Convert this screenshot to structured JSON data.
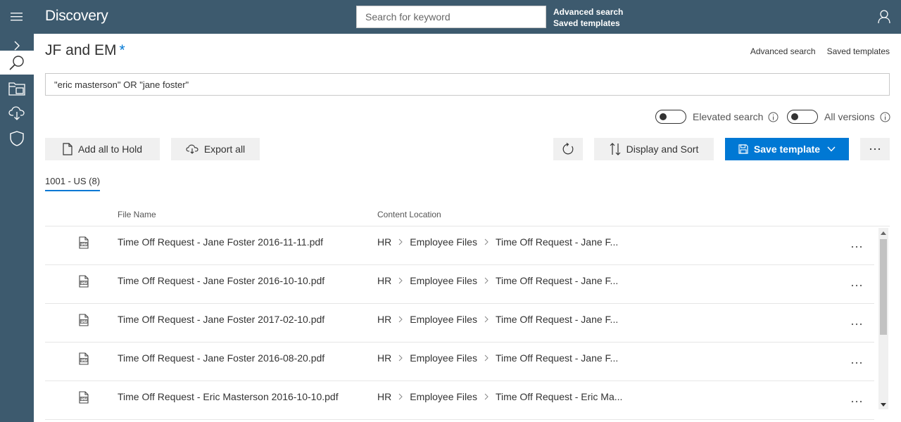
{
  "app": {
    "title": "Discovery",
    "search_placeholder": "Search for keyword",
    "top_links": [
      "Advanced search",
      "Saved templates"
    ]
  },
  "leftnav": {
    "items": [
      {
        "icon": "chevron-right-icon"
      },
      {
        "icon": "search-icon",
        "active": true
      },
      {
        "icon": "folders-icon"
      },
      {
        "icon": "cloud-download-icon"
      },
      {
        "icon": "shield-icon"
      }
    ]
  },
  "page": {
    "title": "JF and EM",
    "unsaved_marker": "*",
    "links": [
      "Advanced search",
      "Saved templates"
    ],
    "query": "\"eric masterson\" OR \"jane foster\""
  },
  "toggles": {
    "elevated_search": {
      "label": "Elevated search",
      "on": false
    },
    "all_versions": {
      "label": "All versions",
      "on": false
    }
  },
  "toolbar": {
    "add_hold": "Add all to Hold",
    "export_all": "Export all",
    "display_sort": "Display and Sort",
    "save_template": "Save template"
  },
  "tabs": [
    {
      "label": "1001 - US (8)",
      "active": true
    }
  ],
  "table": {
    "columns": [
      "File Name",
      "Content Location"
    ],
    "rows": [
      {
        "name": "Time Off Request - Jane Foster 2016-11-11.pdf",
        "location": [
          "HR",
          "Employee Files",
          "Time Off Request - Jane F..."
        ]
      },
      {
        "name": "Time Off Request - Jane Foster 2016-10-10.pdf",
        "location": [
          "HR",
          "Employee Files",
          "Time Off Request - Jane F..."
        ]
      },
      {
        "name": "Time Off Request - Jane Foster 2017-02-10.pdf",
        "location": [
          "HR",
          "Employee Files",
          "Time Off Request - Jane F..."
        ]
      },
      {
        "name": "Time Off Request - Jane Foster 2016-08-20.pdf",
        "location": [
          "HR",
          "Employee Files",
          "Time Off Request - Jane F..."
        ]
      },
      {
        "name": "Time Off Request - Eric Masterson 2016-10-10.pdf",
        "location": [
          "HR",
          "Employee Files",
          "Time Off Request - Eric Ma..."
        ]
      }
    ]
  },
  "colors": {
    "topbar": "#3d5a6e",
    "primary": "#0078d4",
    "button_gray": "#f0f0f0"
  }
}
